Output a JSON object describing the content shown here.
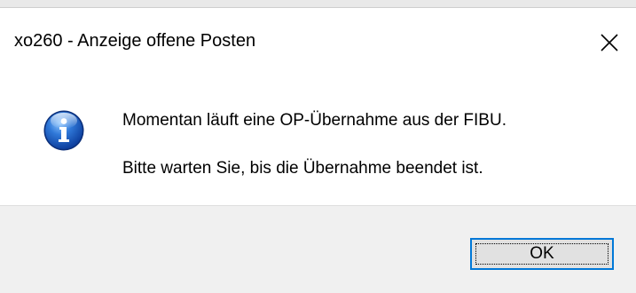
{
  "window": {
    "title": "xo260 - Anzeige offene Posten",
    "close_icon": "close-icon"
  },
  "message": {
    "icon": "info-icon",
    "line1": "Momentan läuft eine OP-Übernahme aus der FIBU.",
    "line2": "Bitte warten Sie, bis die Übernahme beendet ist."
  },
  "buttons": {
    "ok_label": "OK"
  },
  "colors": {
    "accent": "#0078d7",
    "footer_background": "#f0f0f0",
    "button_face": "#e1e1e1"
  }
}
